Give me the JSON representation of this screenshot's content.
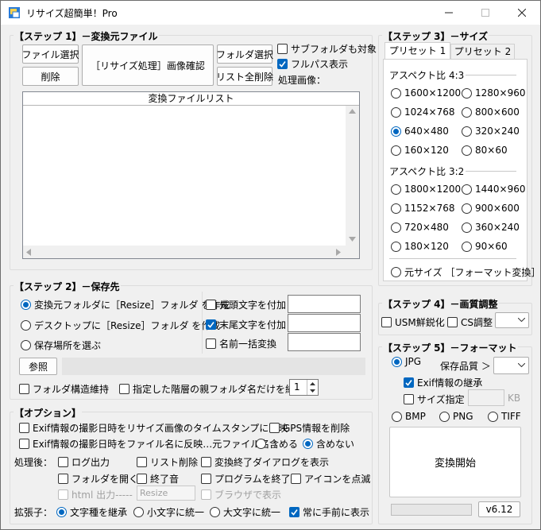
{
  "window": {
    "title": "リサイズ超簡単！Pro"
  },
  "step1": {
    "title": "【ステップ 1】－変換元ファイル",
    "file_select": "ファイル選択",
    "delete": "削除",
    "confirm": "［リサイズ処理］画像確認",
    "folder_select": "フォルダ選択",
    "clear_list": "リスト全削除",
    "subfolder": "サブフォルダも対象",
    "fullpath": "フルパス表示",
    "processing": "処理画像：",
    "list_header": "変換ファイルリスト"
  },
  "step2": {
    "title": "【ステップ 2】－保存先",
    "opt_source": "変換元フォルダに［Resize］フォルダ を作成",
    "opt_desktop": "デスクトップに［Resize］フォルダ を作成",
    "opt_choose": "保存場所を選ぶ",
    "prefix": "先頭文字を付加",
    "suffix": "末尾文字を付加",
    "rename": "名前一括変換",
    "browse": "参照",
    "keep_structure": "フォルダ構造維持",
    "keep_parent": "指定した階層の親フォルダ名だけを維持",
    "level": "1"
  },
  "options": {
    "title": "【オプション】",
    "exif_timestamp": "Exif情報の撮影日時をリサイズ画像のタイムスタンプに反映",
    "gps_delete": "GPS情報を削除",
    "exif_filename": "Exif情報の撮影日時をファイル名に反映…元ファイル名 ：",
    "include": "含める",
    "exclude": "含めない",
    "after_label": "処理後：",
    "log": "ログ出力",
    "list_delete": "リスト削除",
    "show_dialog": "変換終了ダイアログを表示",
    "open_folder": "フォルダを開く",
    "sound": "終了音",
    "exit_program": "プログラムを終了",
    "blink_icon": "アイコンを点滅",
    "html_out": "html 出力-----",
    "html_value": "Resize",
    "browser": "ブラウザで表示",
    "ext_label": "拡張子：",
    "ext_keep": "文字種を継承",
    "ext_lower": "小文字に統一",
    "ext_upper": "大文字に統一",
    "always_top": "常に手前に表示"
  },
  "step3": {
    "title": "【ステップ 3】－サイズ",
    "tab1": "プリセット 1",
    "tab2": "プリセット 2",
    "aspect43": "アスペクト比 4:3",
    "sizes43": [
      "1600×1200",
      "1280×960",
      "1024×768",
      "800×600",
      "640×480",
      "320×240",
      "160×120",
      "80×60"
    ],
    "aspect32": "アスペクト比 3:2",
    "sizes32": [
      "1800×1200",
      "1440×960",
      "1152×768",
      "900×600",
      "720×480",
      "360×240",
      "180×120",
      "90×60"
    ],
    "original": "元サイズ ［フォーマット変換］"
  },
  "step4": {
    "title": "【ステップ 4】－画質調整",
    "usm": "USM鮮鋭化",
    "cs": "CS調整"
  },
  "step5": {
    "title": "【ステップ 5】－フォーマット",
    "jpg": "JPG",
    "quality": "保存品質 ＞",
    "exif_keep": "Exif情報の継承",
    "size_spec": "サイズ指定",
    "kb": "KB",
    "bmp": "BMP",
    "png": "PNG",
    "tiff": "TIFF",
    "start": "変換開始",
    "version": "v6.12"
  },
  "colors": {
    "accent": "#0067c0",
    "face": "#f0f0f0"
  }
}
